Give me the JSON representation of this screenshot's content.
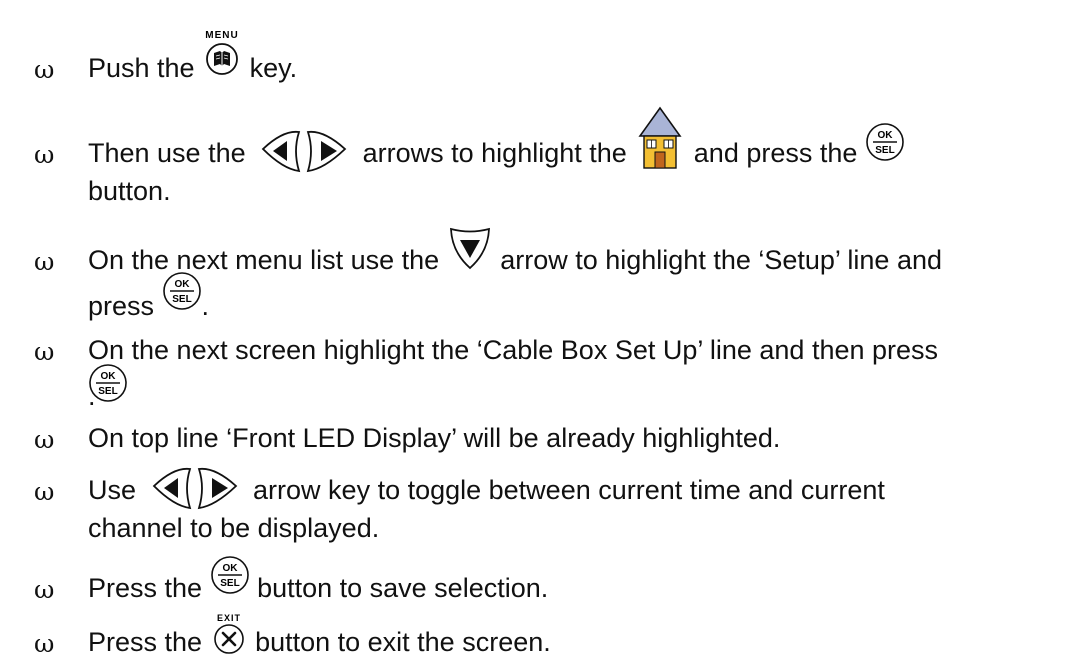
{
  "bullet_symbol": "ω",
  "steps": [
    {
      "parts": [
        "Push the ",
        " key."
      ]
    },
    {
      "parts": [
        "Then use the ",
        " arrows to highlight the ",
        " and press the ",
        "button."
      ]
    },
    {
      "parts": [
        "On the next menu list use the ",
        " arrow to highlight the ‘Setup’ line and",
        "press ",
        "."
      ]
    },
    {
      "parts": [
        "On the next screen highlight the ‘Cable Box Set Up’ line and then press",
        "."
      ]
    },
    {
      "parts": [
        "On top line ‘Front LED Display’ will be already highlighted."
      ]
    },
    {
      "parts": [
        "Use ",
        " arrow key to toggle between current time and current",
        "channel to be displayed."
      ]
    },
    {
      "parts": [
        "Press the ",
        " button to save selection."
      ]
    },
    {
      "parts": [
        "Press the ",
        " button to exit the screen."
      ]
    }
  ],
  "keys": {
    "menu_label": "MENU",
    "ok_label": "OK",
    "sel_label": "SEL",
    "exit_label": "EXIT"
  },
  "icons": {
    "menu_key": "menu-key-icon",
    "left_arrow": "left-arrow-key-icon",
    "right_arrow": "right-arrow-key-icon",
    "down_arrow": "down-arrow-key-icon",
    "home": "home-icon",
    "ok_sel": "ok-sel-key-icon",
    "exit": "exit-key-icon"
  },
  "colors": {
    "house_roof": "#a9b4d6",
    "house_wall": "#f3bf33",
    "house_door": "#c0651d"
  }
}
